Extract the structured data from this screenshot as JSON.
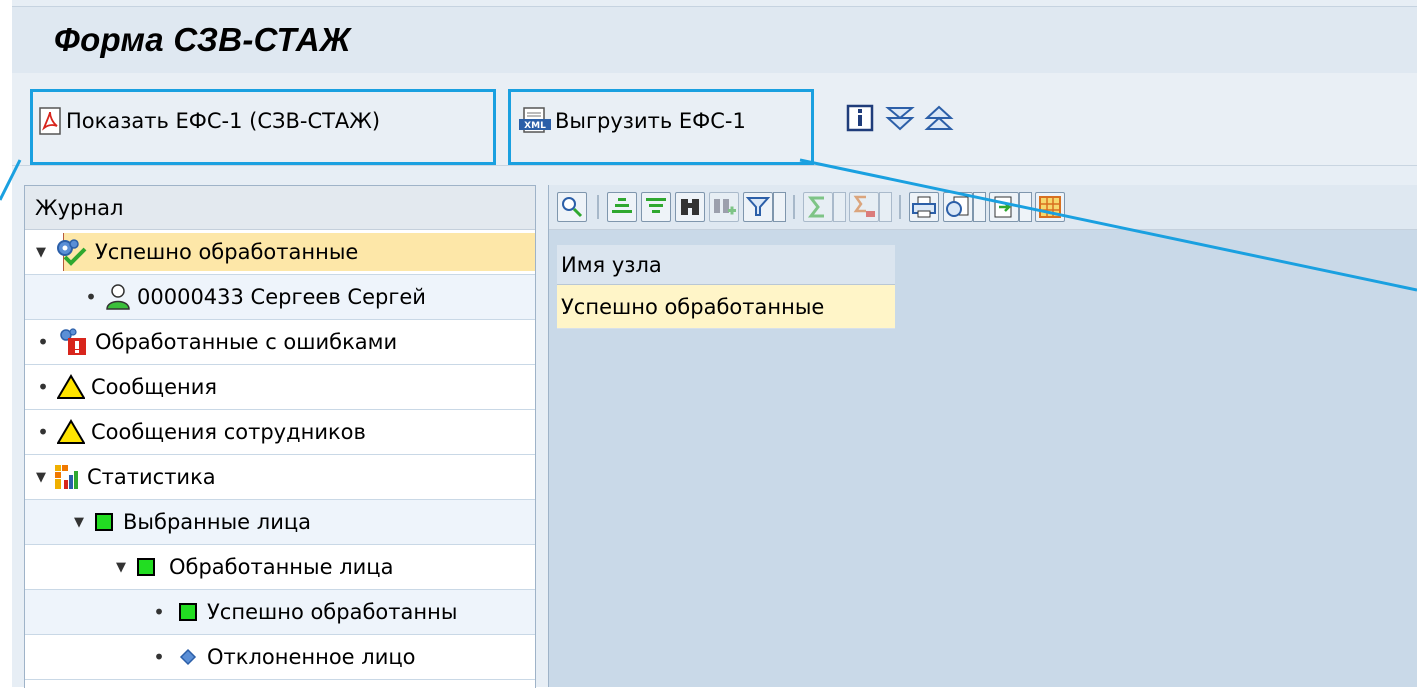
{
  "window": {
    "title": "Форма СЗВ-СТАЖ"
  },
  "toolbar": {
    "show_efs_label": "Показать ЕФС-1 (СЗВ-СТАЖ)",
    "export_efs_label": "Выгрузить ЕФС-1",
    "export_icon_text": "XML"
  },
  "tree": {
    "header": "Журнал",
    "items": [
      {
        "label": "Успешно обработанные",
        "icon": "gear-check-icon",
        "expander": "expanded"
      },
      {
        "label": "00000433 Сергеев Сергей",
        "icon": "person-icon",
        "expander": "leaf"
      },
      {
        "label": "Обработанные с ошибками",
        "icon": "gear-error-icon",
        "expander": "leaf"
      },
      {
        "label": "Сообщения",
        "icon": "warning-icon",
        "expander": "leaf"
      },
      {
        "label": "Сообщения сотрудников",
        "icon": "warning-icon",
        "expander": "leaf"
      },
      {
        "label": "Статистика",
        "icon": "statistics-icon",
        "expander": "expanded"
      },
      {
        "label": "Выбранные лица",
        "icon": "green-square-icon",
        "expander": "expanded"
      },
      {
        "label": "Обработанные лица",
        "icon": "green-square-icon",
        "expander": "expanded"
      },
      {
        "label": "Успешно обработанны",
        "icon": "green-square-icon",
        "expander": "leaf"
      },
      {
        "label": "Отклоненное лицо",
        "icon": "blue-diamond-icon",
        "expander": "leaf"
      }
    ]
  },
  "grid": {
    "column_header": "Имя узла",
    "rows": [
      "Успешно обработанные"
    ]
  },
  "colors": {
    "highlight": "#1aa0e0",
    "selection": "#fde7a8",
    "ok_green": "#22dd22"
  }
}
